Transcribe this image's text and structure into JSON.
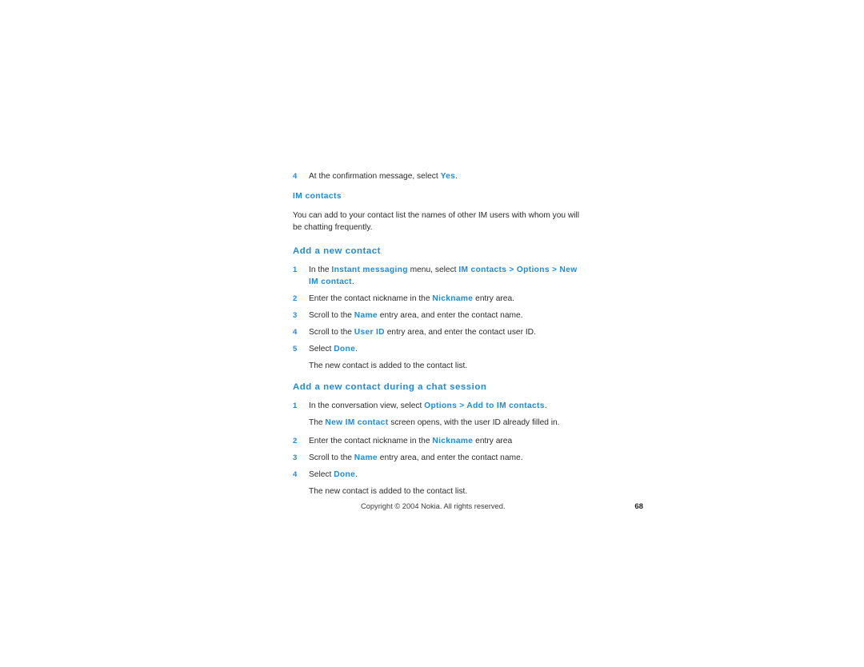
{
  "page": {
    "number": "68",
    "copyright": "Copyright © 2004 Nokia. All rights reserved."
  },
  "blocks": {
    "step4_top": {
      "number": "4",
      "text_before": "At the confirmation message, select ",
      "ui_term": "Yes",
      "text_after": "."
    },
    "heading_im_contacts": "IM contacts",
    "intro_paragraph": "You can add to your contact list the names of other IM users with whom you will be chatting frequently.",
    "heading_add_new_contact": "Add a new contact",
    "add_new_contact_steps": {
      "s1": {
        "number": "1",
        "p1": "In the ",
        "ui1": "Instant messaging",
        "p2": " menu, select ",
        "ui2": "IM contacts > Options > New IM contact",
        "p3": "."
      },
      "s2": {
        "number": "2",
        "p1": "Enter the contact nickname in the ",
        "ui1": "Nickname",
        "p2": " entry area."
      },
      "s3": {
        "number": "3",
        "p1": "Scroll to the ",
        "ui1": "Name",
        "p2": " entry area, and enter the contact name."
      },
      "s4": {
        "number": "4",
        "p1": "Scroll to the ",
        "ui1": "User ID",
        "p2": " entry area, and enter the contact user ID."
      },
      "s5": {
        "number": "5",
        "p1": "Select ",
        "ui1": "Done",
        "p2": "."
      },
      "result": "The new contact is added to the contact list."
    },
    "heading_add_during_chat": "Add a new contact during a chat session",
    "add_during_chat_steps": {
      "s1": {
        "number": "1",
        "p1": "In the conversation view, select ",
        "ui1": "Options > Add to IM contacts",
        "p2": "."
      },
      "s1_note": {
        "p1": "The ",
        "ui1": "New IM contact",
        "p2": " screen opens, with the user ID already filled in."
      },
      "s2": {
        "number": "2",
        "p1": "Enter the contact nickname in the ",
        "ui1": "Nickname",
        "p2": " entry area"
      },
      "s3": {
        "number": "3",
        "p1": "Scroll to the ",
        "ui1": "Name",
        "p2": " entry area, and enter the contact name."
      },
      "s4": {
        "number": "4",
        "p1": "Select ",
        "ui1": "Done",
        "p2": "."
      },
      "result": "The new contact is added to the contact list."
    }
  },
  "colors": {
    "accent_blue": "#1b8ae4",
    "body_text": "#2b2b2b",
    "background": "#ffffff"
  }
}
